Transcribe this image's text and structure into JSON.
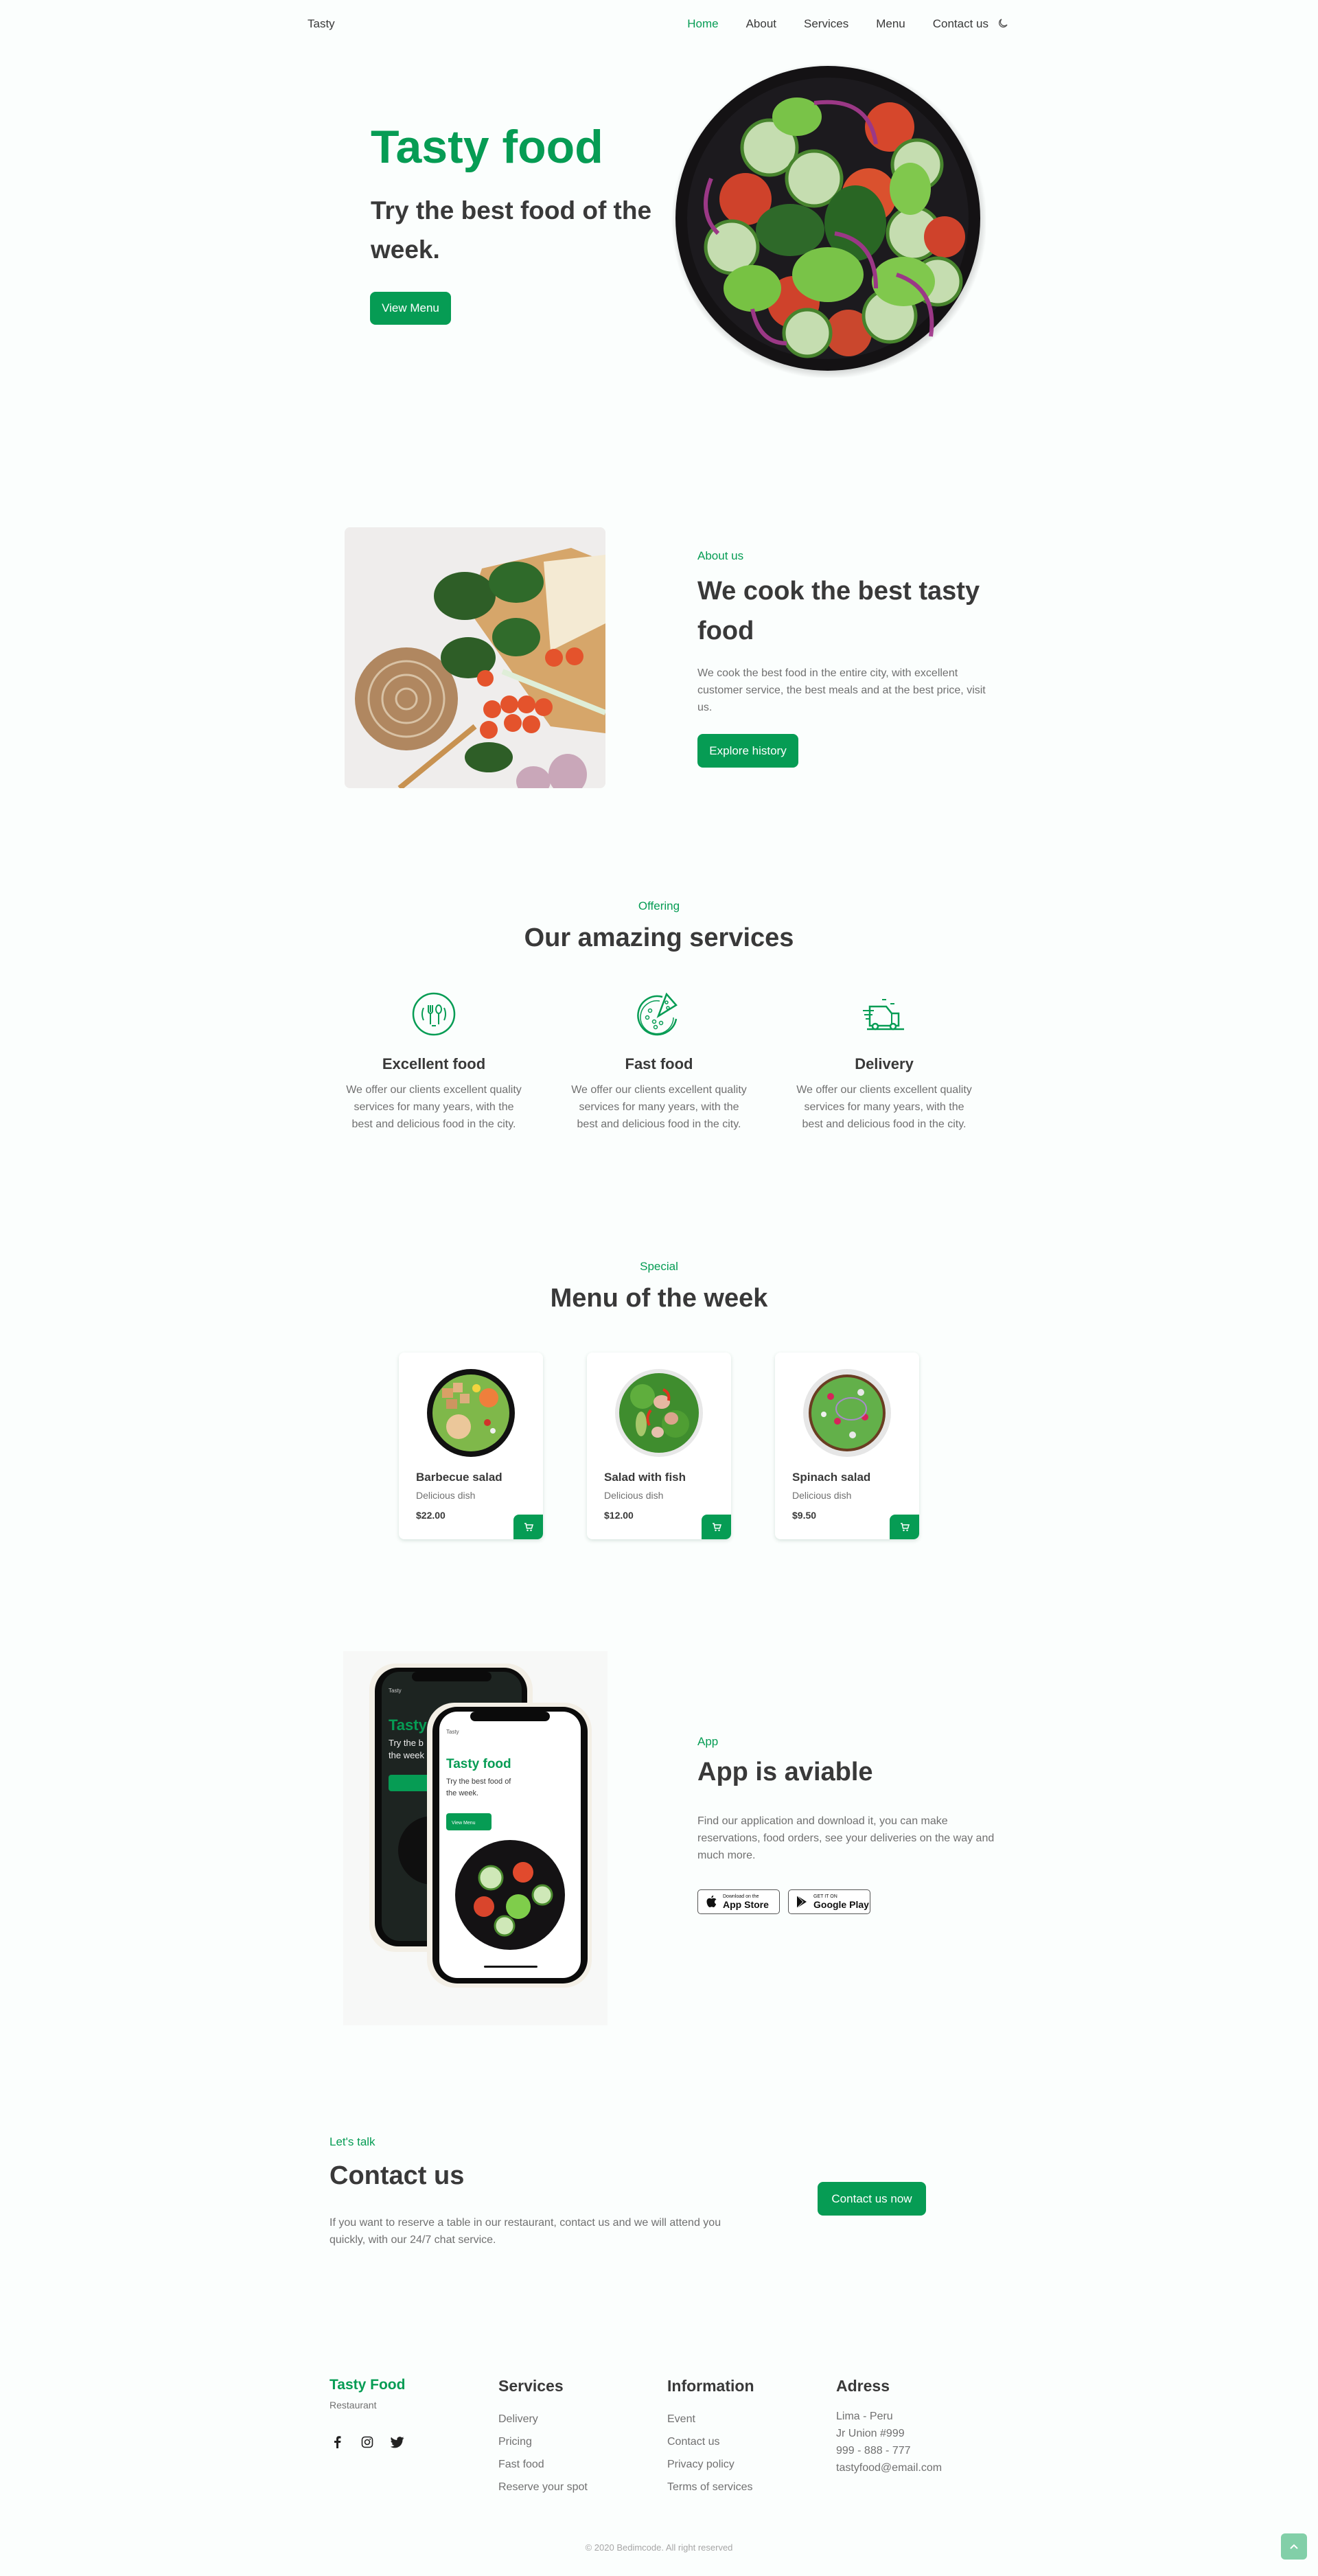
{
  "brand_color": "#069c54",
  "nav": {
    "logo": "Tasty",
    "links": [
      {
        "label": "Home",
        "active": true
      },
      {
        "label": "About",
        "active": false
      },
      {
        "label": "Services",
        "active": false
      },
      {
        "label": "Menu",
        "active": false
      },
      {
        "label": "Contact us",
        "active": false
      }
    ],
    "theme_icon": "moon-icon"
  },
  "hero": {
    "title": "Tasty food",
    "subtitle": "Try the best food of the week.",
    "button": "View Menu",
    "image": "salad-bowl-image"
  },
  "about": {
    "label": "About us",
    "title": "We cook the best tasty food",
    "text": "We cook the best food in the entire city, with excellent customer service, the best meals and at the best price, visit us.",
    "button": "Explore history",
    "image": "ingredients-photo"
  },
  "services": {
    "label": "Offering",
    "title": "Our amazing services",
    "items": [
      {
        "icon": "cutlery-plate-icon",
        "title": "Excellent food",
        "text": "We offer our clients excellent quality services for many years, with the best and delicious food in the city."
      },
      {
        "icon": "pizza-icon",
        "title": "Fast food",
        "text": "We offer our clients excellent quality services for many years, with the best and delicious food in the city."
      },
      {
        "icon": "delivery-truck-icon",
        "title": "Delivery",
        "text": "We offer our clients excellent quality services for many years, with the best and delicious food in the city."
      }
    ]
  },
  "menu": {
    "label": "Special",
    "title": "Menu of the week",
    "items": [
      {
        "name": "Barbecue salad",
        "desc": "Delicious dish",
        "price": "$22.00"
      },
      {
        "name": "Salad with fish",
        "desc": "Delicious dish",
        "price": "$12.00"
      },
      {
        "name": "Spinach salad",
        "desc": "Delicious dish",
        "price": "$9.50"
      }
    ]
  },
  "app": {
    "label": "App",
    "title": "App is aviable",
    "text": "Find our application and download it, you can make reservations, food orders, see your deliveries on the way and much more.",
    "mockup": {
      "logo": "Tasty",
      "title": "Tasty food",
      "subtitle": "Try the best food of the week.",
      "button": "View Menu"
    },
    "app_store": {
      "small": "Download on the",
      "big": "App Store"
    },
    "google_play": {
      "small": "GET IT ON",
      "big": "Google Play"
    }
  },
  "contact": {
    "label": "Let's talk",
    "title": "Contact us",
    "text": "If you want to reserve a table in our restaurant, contact us and we will attend you quickly, with our 24/7 chat service.",
    "button": "Contact us now"
  },
  "footer": {
    "brand": "Tasty Food",
    "sub": "Restaurant",
    "social": [
      "facebook-icon",
      "instagram-icon",
      "twitter-icon"
    ],
    "columns": [
      {
        "title": "Services",
        "links": [
          "Delivery",
          "Pricing",
          "Fast food",
          "Reserve your spot"
        ]
      },
      {
        "title": "Information",
        "links": [
          "Event",
          "Contact us",
          "Privacy policy",
          "Terms of services"
        ]
      }
    ],
    "address": {
      "title": "Adress",
      "lines": [
        "Lima - Peru",
        "Jr Union #999",
        "999 - 888 - 777",
        "tastyfood@email.com"
      ]
    },
    "copyright": "© 2020 Bedimcode. All right reserved"
  }
}
